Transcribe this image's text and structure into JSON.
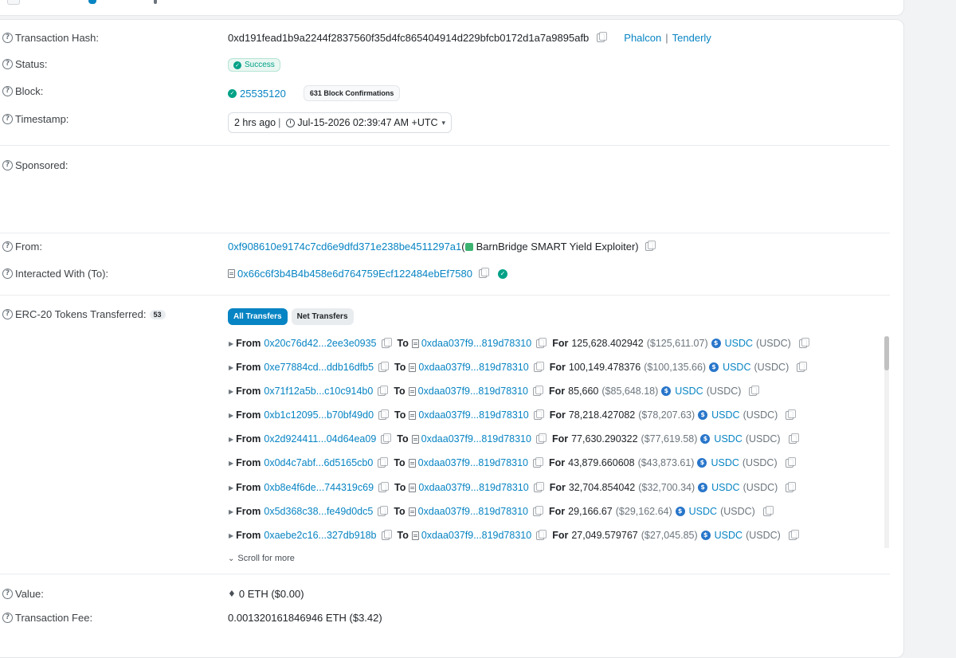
{
  "labels": {
    "tx_hash": "Transaction Hash:",
    "status": "Status:",
    "block": "Block:",
    "timestamp": "Timestamp:",
    "sponsored": "Sponsored:",
    "from": "From:",
    "interacted": "Interacted With (To):",
    "erc20": "ERC-20 Tokens Transferred:",
    "value": "Value:",
    "fee_partial": "Transaction Fee:"
  },
  "tx": {
    "hash": "0xd191fead1b9a2244f2837560f35d4fc865404914d229bfcb0172d1a7a9895afb",
    "phalcon": "Phalcon",
    "separator": "|",
    "tenderly": "Tenderly",
    "status": "Success",
    "block": "25535120",
    "confirmations": "631 Block Confirmations",
    "ts_ago": "2 hrs ago",
    "ts_sep": "|",
    "ts_full": "Jul-15-2026 02:39:47 AM +UTC",
    "from_address": "0xf908610e9174c7cd6e9dfd371e238be4511297a1",
    "from_name": "BarnBridge SMART Yield Exploiter)",
    "from_open": "(",
    "to_address": "0x66c6f3b4B4b458e6d764759Ecf122484ebEf7580",
    "erc20_count": "53",
    "value": "0 ETH ($0.00)",
    "fee_partial": "0.001320161846946 ETH ($3.42)"
  },
  "tabs": {
    "all": "All Transfers",
    "net": "Net Transfers"
  },
  "words": {
    "from": "From",
    "to": "To",
    "for": "For"
  },
  "transfers": [
    {
      "from": "0x20c76d42...2ee3e0935",
      "to": "0xdaa037f9...819d78310",
      "amount": "125,628.402942",
      "usd": "($125,611.07)",
      "token": "USDC",
      "symbol": "(USDC)"
    },
    {
      "from": "0xe77884cd...ddb16dfb5",
      "to": "0xdaa037f9...819d78310",
      "amount": "100,149.478376",
      "usd": "($100,135.66)",
      "token": "USDC",
      "symbol": "(USDC)"
    },
    {
      "from": "0x71f12a5b...c10c914b0",
      "to": "0xdaa037f9...819d78310",
      "amount": "85,660",
      "usd": "($85,648.18)",
      "token": "USDC",
      "symbol": "(USDC)"
    },
    {
      "from": "0xb1c12095...b70bf49d0",
      "to": "0xdaa037f9...819d78310",
      "amount": "78,218.427082",
      "usd": "($78,207.63)",
      "token": "USDC",
      "symbol": "(USDC)"
    },
    {
      "from": "0x2d924411...04d64ea09",
      "to": "0xdaa037f9...819d78310",
      "amount": "77,630.290322",
      "usd": "($77,619.58)",
      "token": "USDC",
      "symbol": "(USDC)"
    },
    {
      "from": "0x0d4c7abf...6d5165cb0",
      "to": "0xdaa037f9...819d78310",
      "amount": "43,879.660608",
      "usd": "($43,873.61)",
      "token": "USDC",
      "symbol": "(USDC)"
    },
    {
      "from": "0xb8e4f6de...744319c69",
      "to": "0xdaa037f9...819d78310",
      "amount": "32,704.854042",
      "usd": "($32,700.34)",
      "token": "USDC",
      "symbol": "(USDC)"
    },
    {
      "from": "0x5d368c38...fe49d0dc5",
      "to": "0xdaa037f9...819d78310",
      "amount": "29,166.67",
      "usd": "($29,162.64)",
      "token": "USDC",
      "symbol": "(USDC)"
    },
    {
      "from": "0xaebe2c16...327db918b",
      "to": "0xdaa037f9...819d78310",
      "amount": "27,049.579767",
      "usd": "($27,045.85)",
      "token": "USDC",
      "symbol": "(USDC)"
    }
  ],
  "scroll_more": "Scroll for more",
  "colors": {
    "link": "#0784c3",
    "success": "#00a186",
    "usdc": "#2775ca"
  }
}
